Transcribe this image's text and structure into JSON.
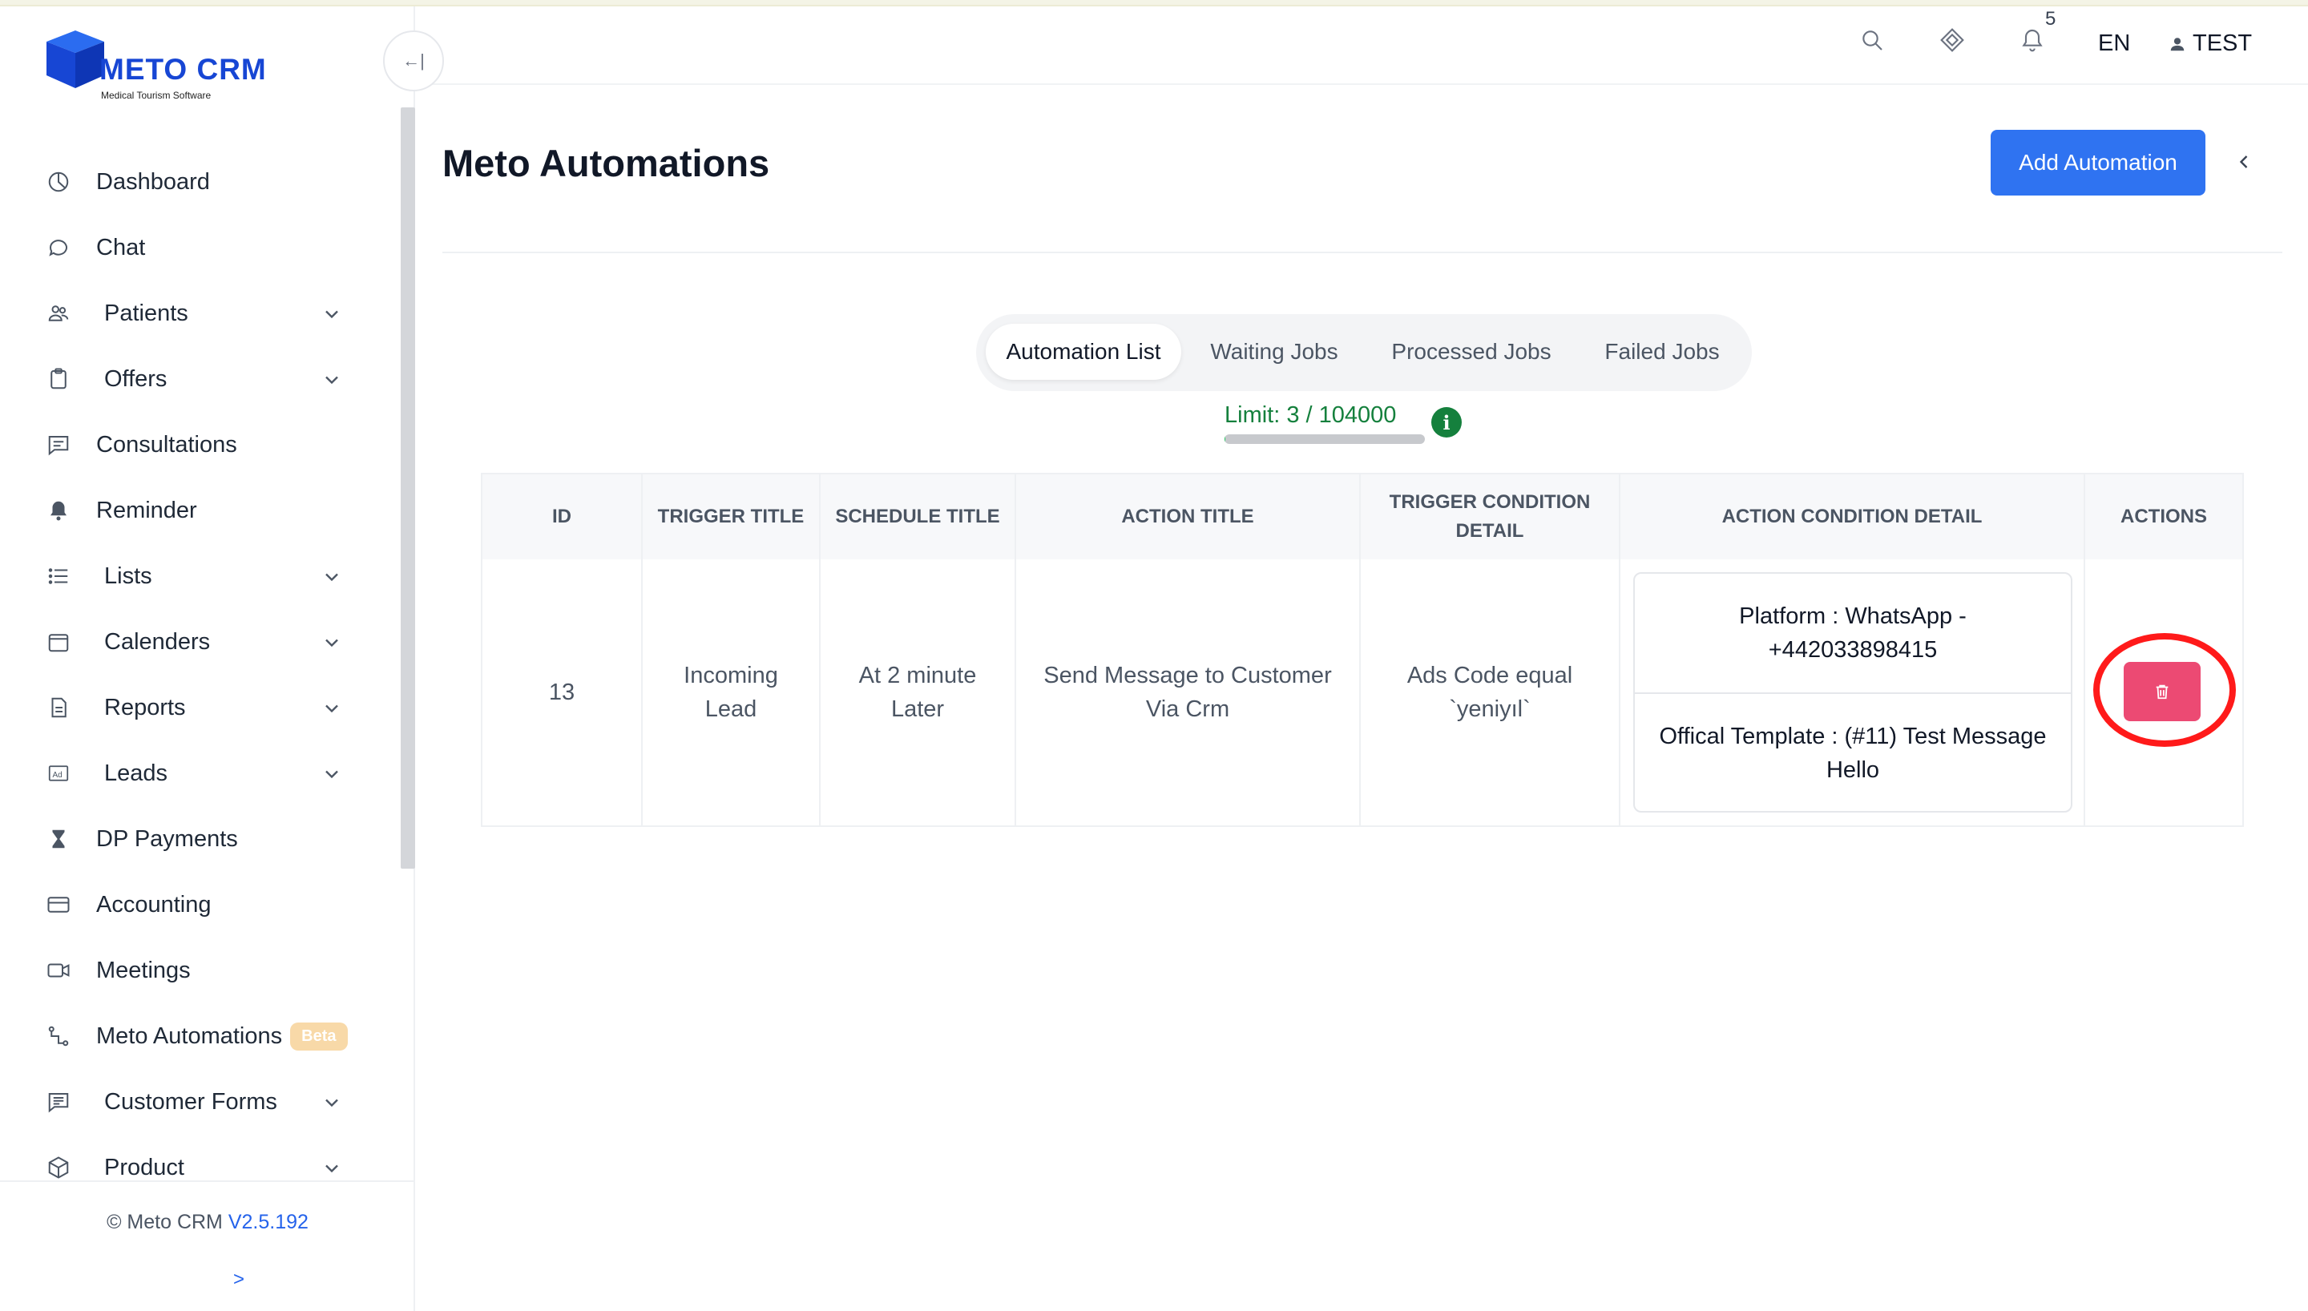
{
  "app": {
    "logo_text": "METO CRM",
    "logo_subtitle": "Medical Tourism Software",
    "brand_color": "#1746d4"
  },
  "sidebar": {
    "items": [
      {
        "label": "Dashboard",
        "icon": "pie-chart-icon",
        "has_submenu": false
      },
      {
        "label": "Chat",
        "icon": "chat-bubble-icon",
        "has_submenu": false
      },
      {
        "label": "Patients",
        "icon": "users-icon",
        "has_submenu": true
      },
      {
        "label": "Offers",
        "icon": "clipboard-icon",
        "has_submenu": true
      },
      {
        "label": "Consultations",
        "icon": "message-square-icon",
        "has_submenu": false
      },
      {
        "label": "Reminder",
        "icon": "bell-icon",
        "has_submenu": false
      },
      {
        "label": "Lists",
        "icon": "list-icon",
        "has_submenu": true
      },
      {
        "label": "Calenders",
        "icon": "calendar-icon",
        "has_submenu": true
      },
      {
        "label": "Reports",
        "icon": "document-icon",
        "has_submenu": true
      },
      {
        "label": "Leads",
        "icon": "ad-icon",
        "has_submenu": true
      },
      {
        "label": "DP Payments",
        "icon": "hourglass-icon",
        "has_submenu": false
      },
      {
        "label": "Accounting",
        "icon": "credit-card-icon",
        "has_submenu": false
      },
      {
        "label": "Meetings",
        "icon": "video-icon",
        "has_submenu": false
      },
      {
        "label": "Meto Automations",
        "icon": "automation-icon",
        "has_submenu": false,
        "badge": "Beta"
      },
      {
        "label": "Customer Forms",
        "icon": "form-icon",
        "has_submenu": true
      },
      {
        "label": "Product",
        "icon": "box-icon",
        "has_submenu": true
      }
    ],
    "footer": {
      "copyright": "© Meto CRM",
      "version": "V2.5.192",
      "expand_label": ">"
    },
    "collapse_label": "←|"
  },
  "header": {
    "notification_count": "5",
    "language": "EN",
    "user_name": "TEST"
  },
  "main": {
    "title": "Meto Automations",
    "add_button_label": "Add Automation",
    "tabs": [
      {
        "label": "Automation List",
        "active": true
      },
      {
        "label": "Waiting Jobs",
        "active": false
      },
      {
        "label": "Processed Jobs",
        "active": false
      },
      {
        "label": "Failed Jobs",
        "active": false
      }
    ],
    "limit_text": "Limit: 3 / 104000",
    "limit_used": 3,
    "limit_total": 104000,
    "table": {
      "columns": [
        "ID",
        "TRIGGER TITLE",
        "SCHEDULE TITLE",
        "ACTION TITLE",
        "TRIGGER CONDITION DETAIL",
        "ACTION CONDITION DETAIL",
        "ACTIONS"
      ],
      "rows": [
        {
          "id": "13",
          "trigger_title": "Incoming Lead",
          "schedule_title": "At 2 minute Later",
          "action_title": "Send Message to Customer Via Crm",
          "trigger_condition": "Ads Code equal `yeniyıl`",
          "action_condition": {
            "platform": "Platform : WhatsApp - +442033898415",
            "template": "Offical Template : (#11) Test Message Hello"
          }
        }
      ]
    }
  },
  "colors": {
    "primary_button": "#2f73f1",
    "delete_button": "#ec4a73",
    "limit_text": "#15803d",
    "highlight_ring": "#ff1a1a"
  }
}
